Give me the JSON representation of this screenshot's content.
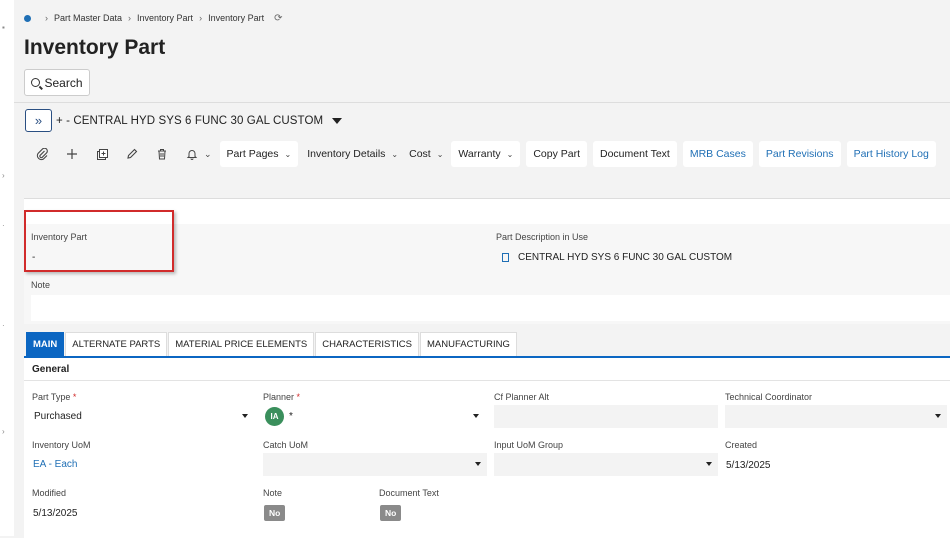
{
  "breadcrumb": {
    "items": [
      "Part Master Data",
      "Inventory Part",
      "Inventory Part"
    ]
  },
  "page": {
    "title": "Inventory Part"
  },
  "search": {
    "label": "Search"
  },
  "record": {
    "title": "+ - CENTRAL HYD SYS 6 FUNC 30 GAL CUSTOM"
  },
  "toolbar": {
    "icons": [
      "attach-icon",
      "add-icon",
      "duplicate-icon",
      "edit-icon",
      "delete-icon",
      "bell-icon"
    ],
    "menus": [
      "Part Pages",
      "Inventory Details",
      "Cost",
      "Warranty"
    ],
    "buttons": [
      "Copy Part",
      "Document Text"
    ],
    "links": [
      "MRB Cases",
      "Part Revisions",
      "Part History Log"
    ]
  },
  "header_group": {
    "inventory_part_label": "Inventory Part",
    "inventory_part_value": "-",
    "part_description_label": "Part Description in Use",
    "part_description_value": "CENTRAL HYD SYS 6 FUNC 30 GAL CUSTOM",
    "note_label": "Note"
  },
  "tabs": [
    "MAIN",
    "ALTERNATE PARTS",
    "MATERIAL PRICE ELEMENTS",
    "CHARACTERISTICS",
    "MANUFACTURING"
  ],
  "form": {
    "section_title": "General",
    "part_type": {
      "label": "Part Type",
      "required": "*",
      "value": "Purchased"
    },
    "planner": {
      "label": "Planner",
      "required": "*",
      "avatar": "IA",
      "value": "*"
    },
    "cf_planner_alt": {
      "label": "Cf Planner Alt"
    },
    "technical_coordinator": {
      "label": "Technical Coordinator"
    },
    "inventory_uom": {
      "label": "Inventory UoM",
      "value": "EA - Each"
    },
    "catch_uom": {
      "label": "Catch UoM"
    },
    "input_uom_group": {
      "label": "Input UoM Group"
    },
    "created": {
      "label": "Created",
      "value": "5/13/2025"
    },
    "modified": {
      "label": "Modified",
      "value": "5/13/2025"
    },
    "note": {
      "label": "Note",
      "value": "No"
    },
    "document_text": {
      "label": "Document Text",
      "value": "No"
    }
  },
  "colors": {
    "accent": "#0b66c2",
    "link": "#1f6fb5",
    "highlight": "#d12b2b",
    "avatar": "#3a8f5c"
  }
}
